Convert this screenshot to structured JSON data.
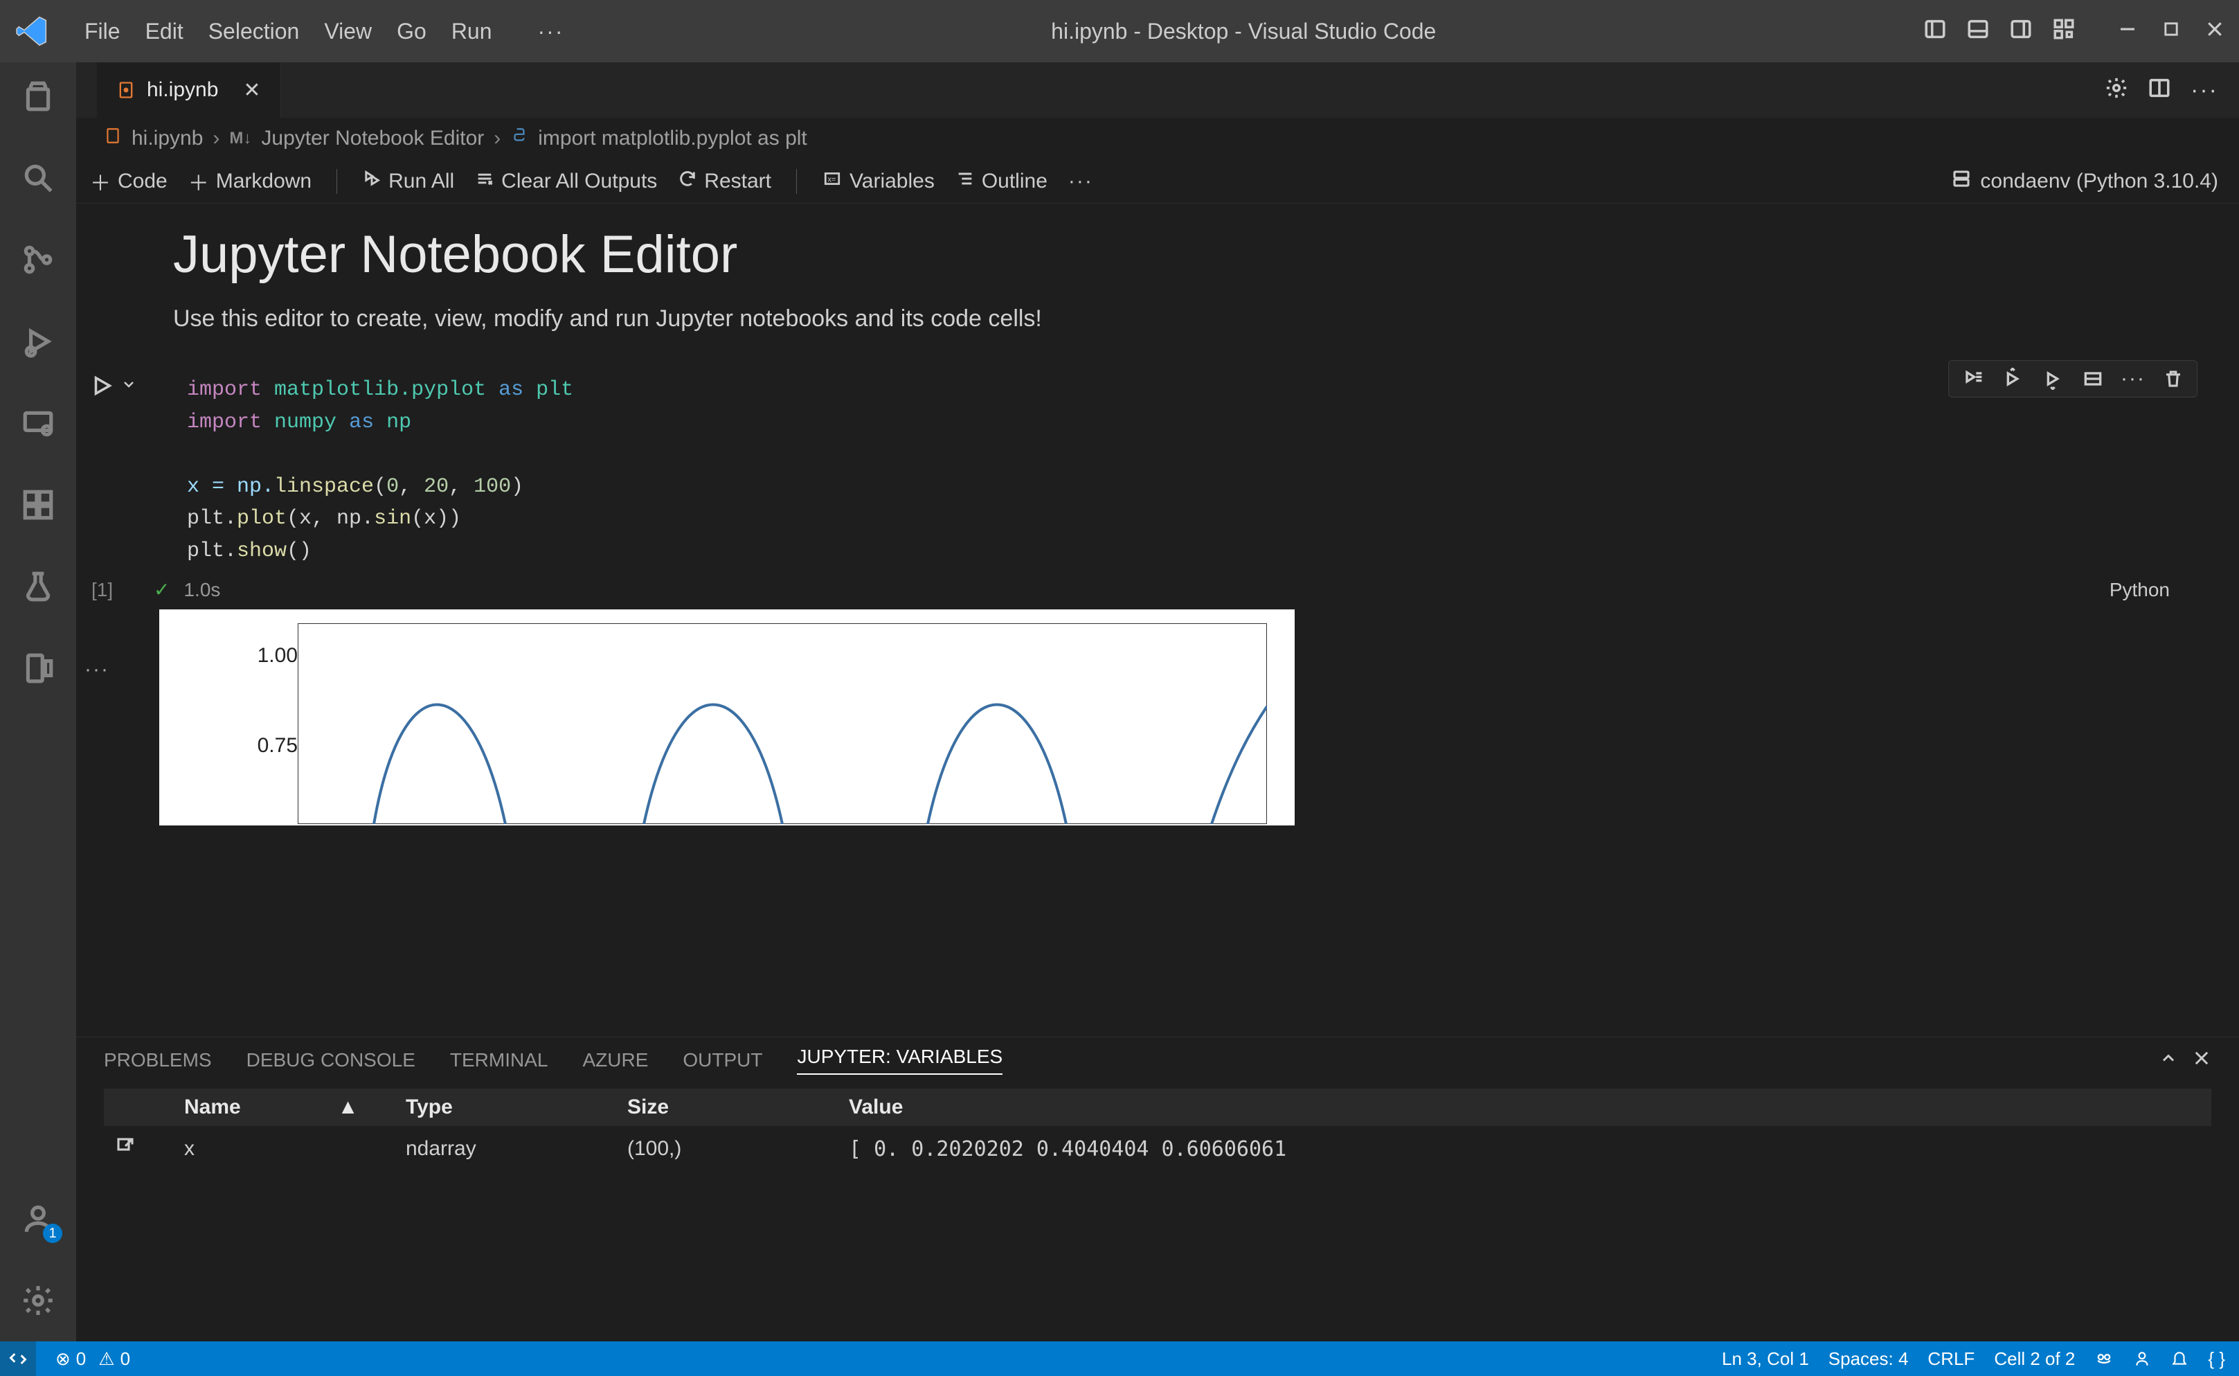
{
  "titlebar": {
    "menu": [
      "File",
      "Edit",
      "Selection",
      "View",
      "Go",
      "Run"
    ],
    "title": "hi.ipynb - Desktop - Visual Studio Code"
  },
  "tab": {
    "filename": "hi.ipynb"
  },
  "breadcrumb": {
    "file": "hi.ipynb",
    "section": "Jupyter Notebook Editor",
    "cell": "import matplotlib.pyplot as plt"
  },
  "nbtoolbar": {
    "code": "Code",
    "markdown": "Markdown",
    "runall": "Run All",
    "clear": "Clear All Outputs",
    "restart": "Restart",
    "variables": "Variables",
    "outline": "Outline",
    "kernel": "condaenv (Python 3.10.4)"
  },
  "notebook": {
    "heading": "Jupyter Notebook Editor",
    "para": "Use this editor to create, view, modify and run Jupyter notebooks and its code cells!",
    "code": {
      "line1a": "import",
      "line1b": "matplotlib.pyplot",
      "line1c": "as",
      "line1d": "plt",
      "line2a": "import",
      "line2b": "numpy",
      "line2c": "as",
      "line2d": "np",
      "line4a": "x = np.",
      "line4b": "linspace",
      "line4c": "(",
      "line4n1": "0",
      "line4s1": ", ",
      "line4n2": "20",
      "line4s2": ", ",
      "line4n3": "100",
      "line4e": ")",
      "line5": "plt.plot(x, np.sin(x))",
      "line5a": "plt.",
      "line5b": "plot",
      "line5c": "(x, np.",
      "line5d": "sin",
      "line5e": "(x))",
      "line6a": "plt.",
      "line6b": "show",
      "line6c": "()"
    },
    "exec": {
      "idx": "[1]",
      "time": "1.0s",
      "lang": "Python"
    },
    "yticks": {
      "t1": "1.00",
      "t2": "0.75"
    }
  },
  "panel": {
    "tabs": [
      "PROBLEMS",
      "DEBUG CONSOLE",
      "TERMINAL",
      "AZURE",
      "OUTPUT",
      "JUPYTER: VARIABLES"
    ],
    "headers": {
      "name": "Name",
      "type": "Type",
      "size": "Size",
      "value": "Value"
    },
    "row": {
      "name": "x",
      "type": "ndarray",
      "size": "(100,)",
      "value": "[ 0.          0.2020202   0.4040404   0.60606061"
    }
  },
  "statusbar": {
    "remote_badge": "",
    "errors": "0",
    "warnings": "0",
    "lncol": "Ln 3, Col 1",
    "spaces": "Spaces: 4",
    "eol": "CRLF",
    "cell": "Cell 2 of 2"
  },
  "accounts_badge": "1",
  "chart_data": {
    "type": "line",
    "title": "",
    "xlabel": "",
    "ylabel": "",
    "x_range": [
      0,
      20
    ],
    "ylim": [
      -1.0,
      1.0
    ],
    "visible_y_ticks": [
      1.0,
      0.75
    ],
    "series": [
      {
        "name": "sin(x)",
        "expr": "sin(x) for x in linspace(0,20,100)"
      }
    ],
    "note": "Only top portion of plot (y≈0.6 to 1.0) is visible in the screenshot."
  }
}
